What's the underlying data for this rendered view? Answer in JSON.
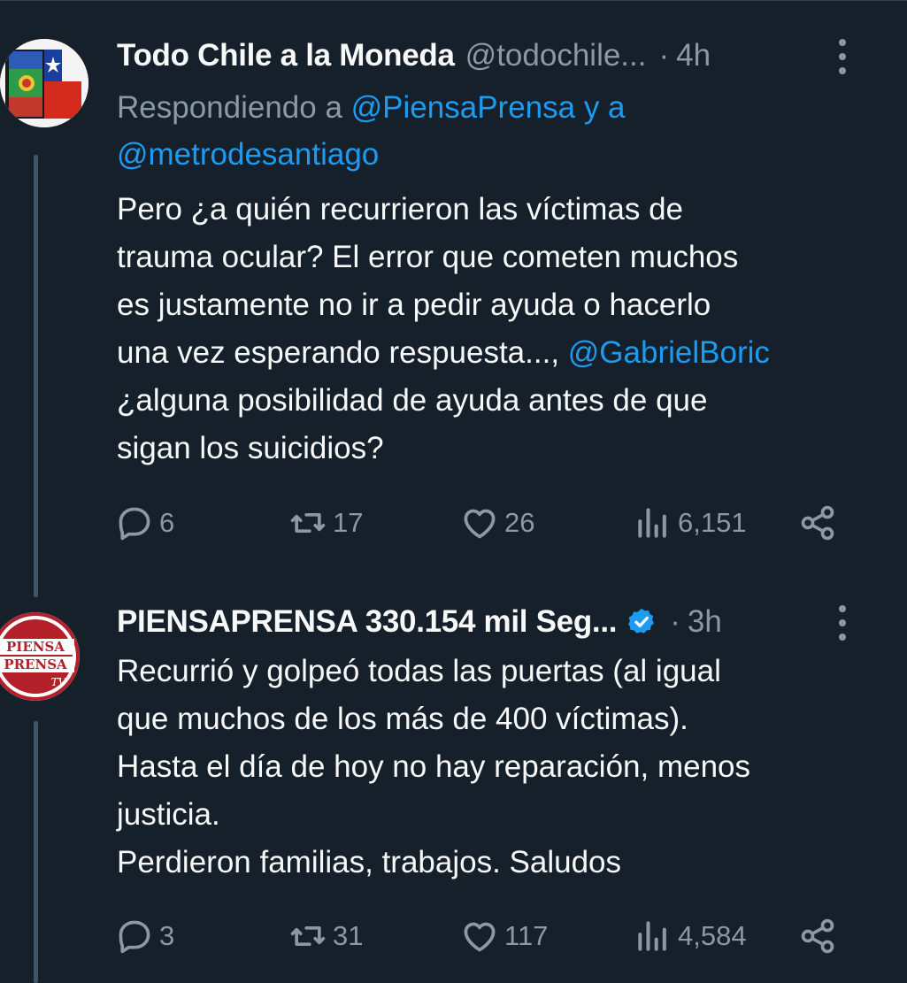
{
  "tweets": [
    {
      "display_name": "Todo Chile a la Moneda",
      "handle": "@todochile...",
      "time": "4h",
      "reply_to_prefix": "Respondiendo a ",
      "reply_to_user1": "@PiensaPrensa",
      "reply_to_join": " y a",
      "reply_to_user2": "@metrodesantiago",
      "text_part1": "Pero ¿a quién recurrieron las víctimas de\ntrauma ocular? El error que cometen muchos\nes justamente no ir a pedir ayuda o hacerlo\nuna vez esperando respuesta..., ",
      "text_mention": "@GabrielBoric",
      "text_part2": "\n¿alguna posibilidad de ayuda antes de que\nsigan los suicidios?",
      "replies": "6",
      "retweets": "17",
      "likes": "26",
      "views": "6,151"
    },
    {
      "display_name": "PIENSAPRENSA 330.154 mil Seg...",
      "time": "3h",
      "avatar_text_line1": "PIENSA",
      "avatar_text_line2": "PRENSA",
      "avatar_text_line3": "TV",
      "text": "Recurrió y golpeó todas las puertas (al igual\nque muchos de los más de 400 víctimas).\nHasta el día de hoy no hay reparación, menos\njusticia.\nPerdieron familias, trabajos. Saludos",
      "replies": "3",
      "retweets": "31",
      "likes": "117",
      "views": "4,584"
    }
  ],
  "separator": "·",
  "colors": {
    "background": "#15202b",
    "text_primary": "#f7f9f9",
    "text_secondary": "#8b98a5",
    "link": "#1d9bf0",
    "thread_line": "#425566",
    "verified": "#1d9bf0"
  },
  "icons": [
    "reply-icon",
    "retweet-icon",
    "like-icon",
    "views-icon",
    "share-icon",
    "more-icon",
    "verified-badge-icon"
  ]
}
